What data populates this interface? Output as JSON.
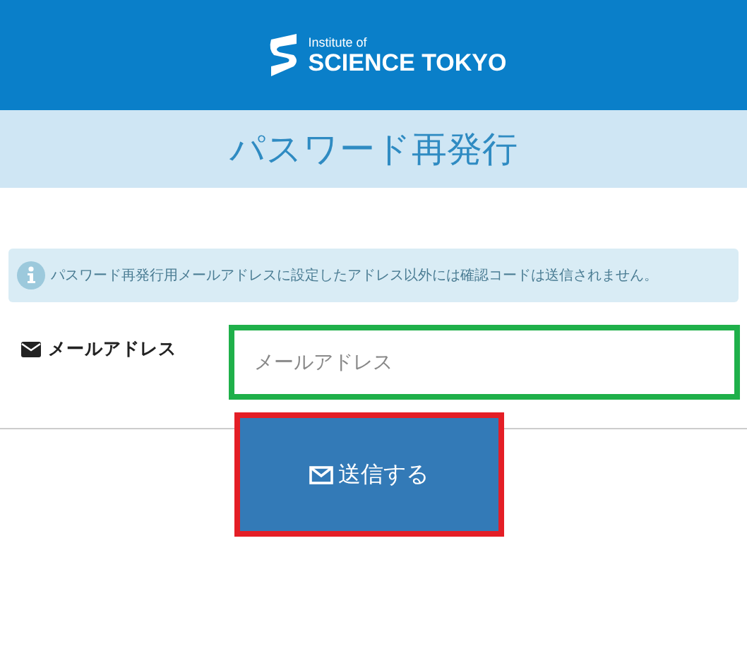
{
  "header": {
    "logo_small": "Institute of",
    "logo_large": "SCIENCE TOKYO"
  },
  "title": "パスワード再発行",
  "notice": "パスワード再発行用メールアドレスに設定したアドレス以外には確認コードは送信されません。",
  "form": {
    "label": "メールアドレス",
    "placeholder": "メールアドレス"
  },
  "submit": "送信する"
}
